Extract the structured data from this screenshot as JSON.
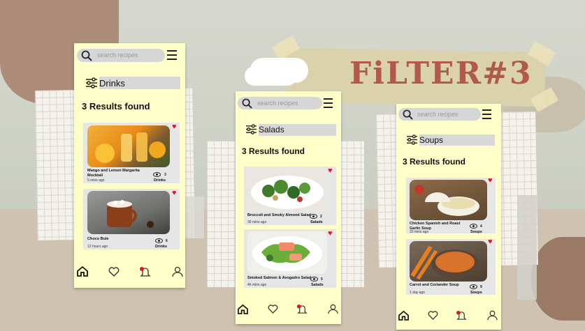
{
  "header": {
    "title": "FiLTER#3"
  },
  "search": {
    "placeholder": "search recipes"
  },
  "screens": [
    {
      "filter": "Drinks",
      "results": "3 Results found",
      "cards": [
        {
          "title": "Mango and Lemon Margarita Mocktail",
          "time": "5 mins ago",
          "count": "3",
          "category": "Drinks"
        },
        {
          "title": "Choco Bule",
          "time": "12 hours ago",
          "count": "6",
          "category": "Drinks"
        }
      ]
    },
    {
      "filter": "Salads",
      "results": "3 Results found",
      "cards": [
        {
          "title": "Broccoli and Smoky Almond Salad",
          "time": "30 mins ago",
          "count": "2",
          "category": "Salads"
        },
        {
          "title": "Smoked Salmon & Avogadro Salad",
          "time": "4h mins ago",
          "count": "5",
          "category": "Salads"
        }
      ]
    },
    {
      "filter": "Soups",
      "results": "3 Results found",
      "cards": [
        {
          "title": "Chicken Spanish and Roast Garlic Soup",
          "time": "20 mins ago",
          "count": "4",
          "category": "Soups"
        },
        {
          "title": "Carrot and Coriander Soup",
          "time": "1 day ago",
          "count": "9",
          "category": "Soups"
        }
      ]
    }
  ],
  "colors": {
    "screen": "#fefec8",
    "heart": "#e0152b",
    "title": "#b05a4a"
  },
  "icons": [
    "search-icon",
    "menu-icon",
    "filter-icon",
    "heart-icon",
    "eye-icon",
    "home-icon",
    "favorites-icon",
    "notification-icon",
    "profile-icon"
  ]
}
